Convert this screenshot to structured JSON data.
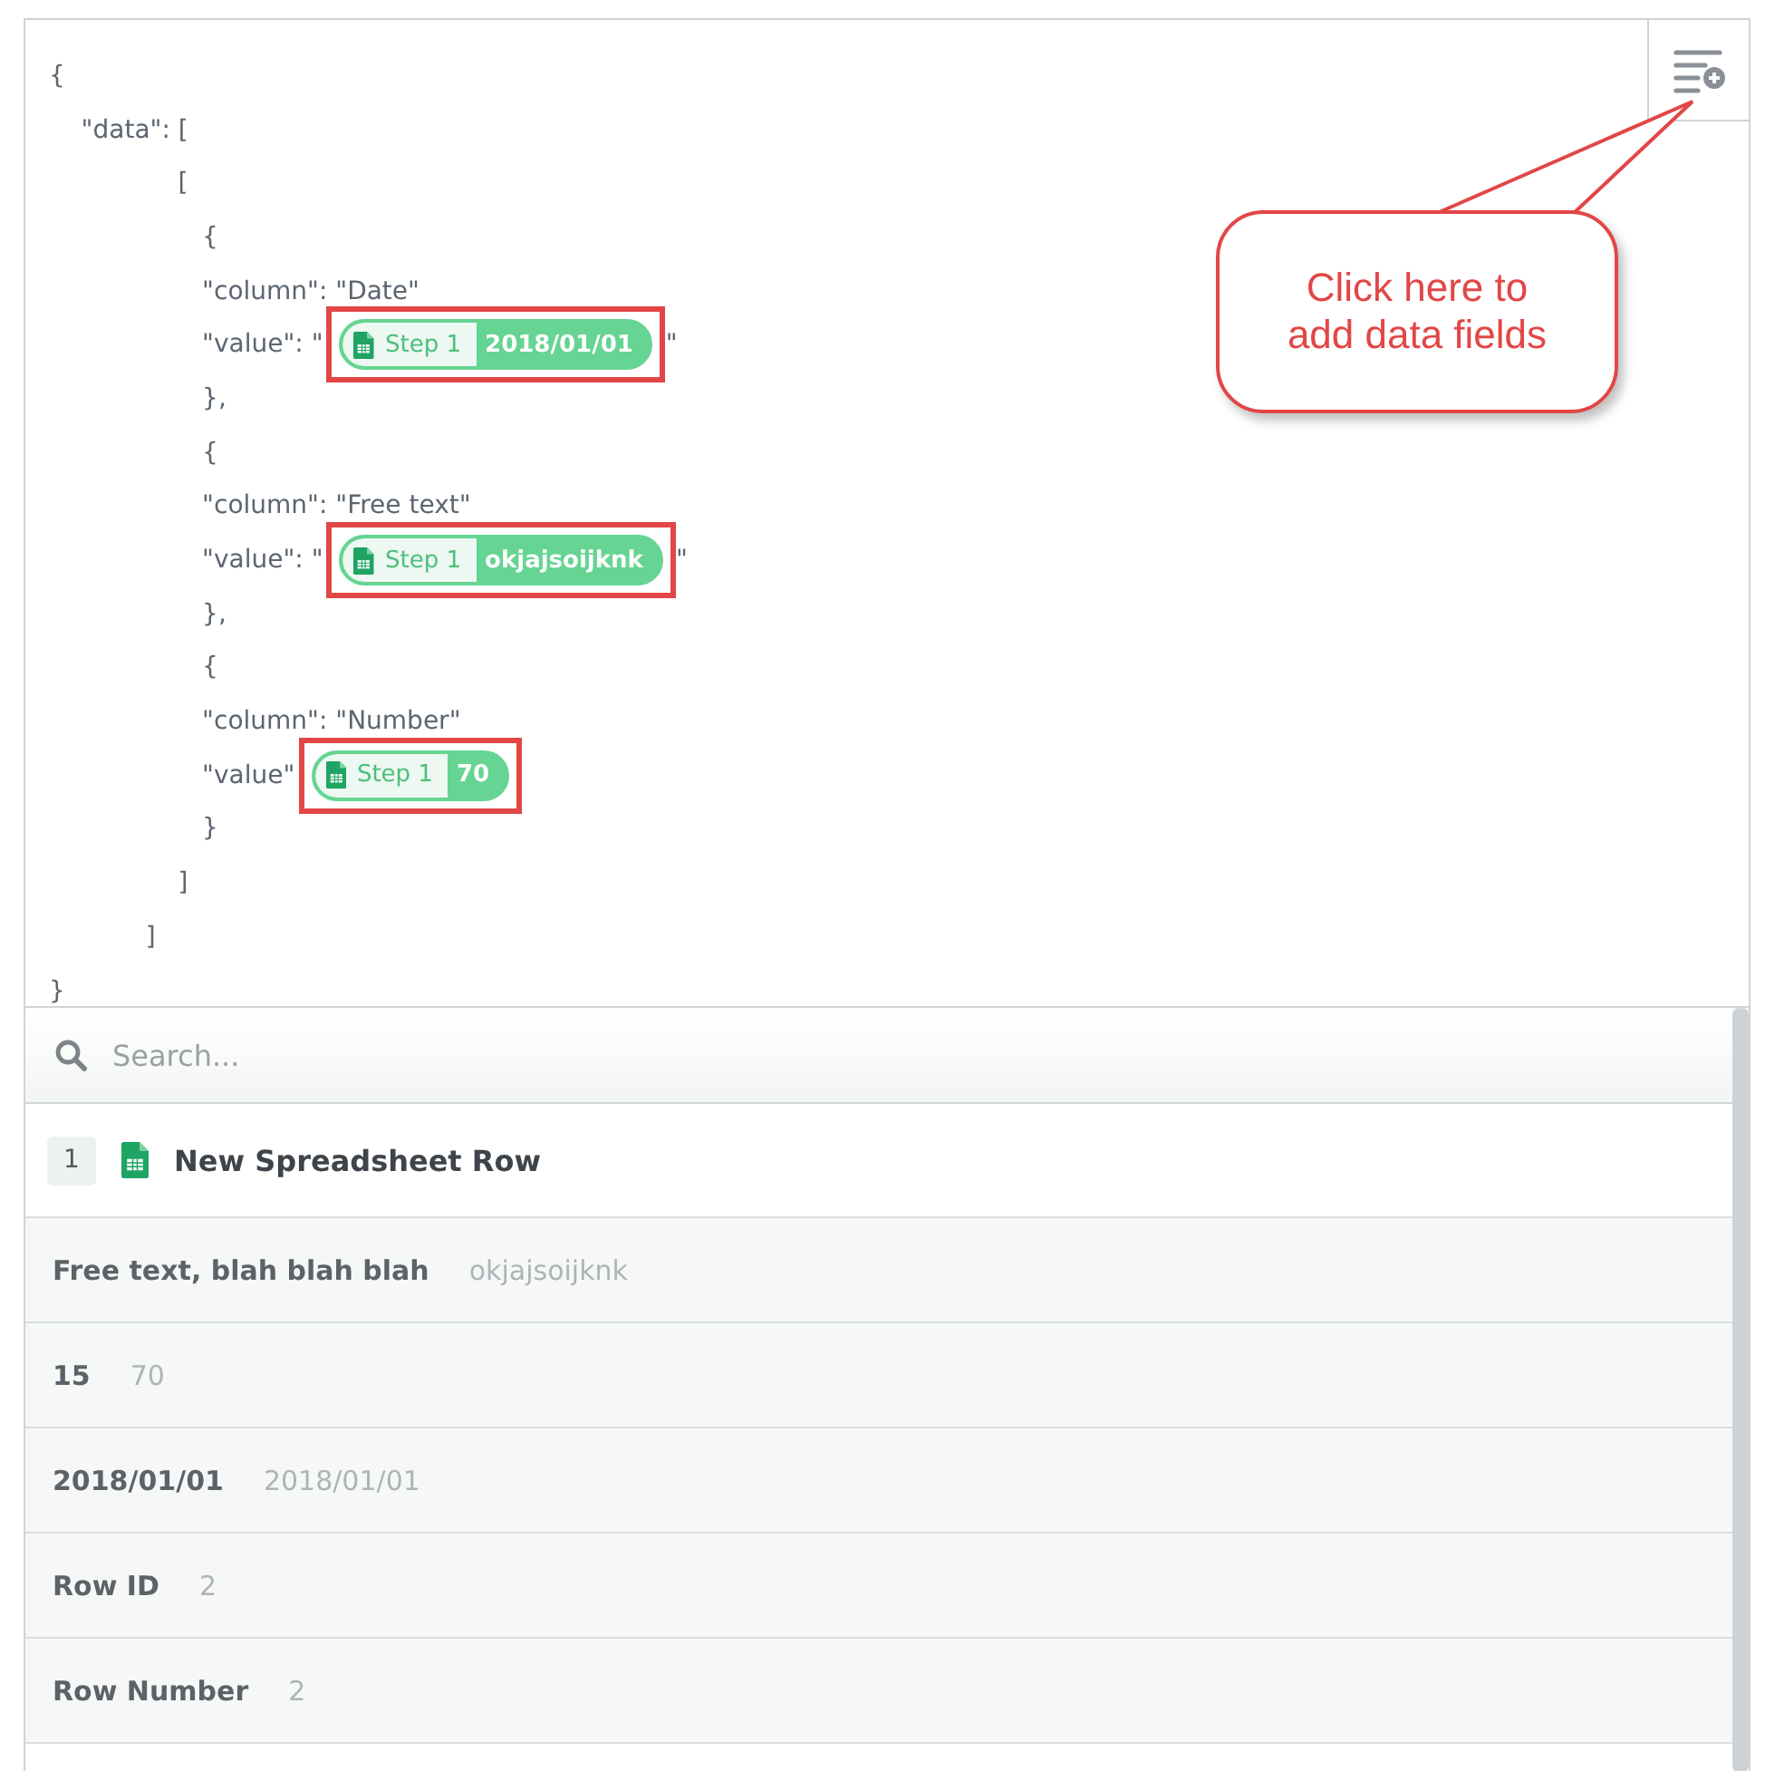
{
  "editor": {
    "lines": [
      [
        {
          "text": "{"
        }
      ],
      [
        {
          "text": "    \"data\": ["
        }
      ],
      [
        {
          "text": "                ["
        }
      ],
      [
        {
          "text": "                   {"
        }
      ],
      [
        {
          "text": "                   \"column\": \"Date\""
        }
      ],
      [
        {
          "text": "                   \"value\": \""
        },
        {
          "pill": {
            "step": "Step 1",
            "value": "2018/01/01",
            "annotated": true
          }
        },
        {
          "text": "\""
        }
      ],
      [
        {
          "text": "                   },"
        }
      ],
      [
        {
          "text": "                   {"
        }
      ],
      [
        {
          "text": "                   \"column\": \"Free text\""
        }
      ],
      [
        {
          "text": "                   \"value\": \""
        },
        {
          "pill": {
            "step": "Step 1",
            "value": "okjajsoijknk",
            "annotated": true
          }
        },
        {
          "text": "\""
        }
      ],
      [
        {
          "text": "                   },"
        }
      ],
      [
        {
          "text": "                   {"
        }
      ],
      [
        {
          "text": "                   \"column\": \"Number\""
        }
      ],
      [
        {
          "text": "                   \"value\""
        },
        {
          "pill": {
            "step": "Step 1",
            "value": "70",
            "annotated": true
          }
        }
      ],
      [
        {
          "text": "                   }"
        }
      ],
      [
        {
          "text": "                ]"
        }
      ],
      [
        {
          "text": "            ]"
        }
      ],
      [
        {
          "text": "}"
        }
      ]
    ]
  },
  "callout": {
    "text": "Click here to add data fields"
  },
  "search": {
    "placeholder": "Search..."
  },
  "step": {
    "number": "1",
    "title": "New Spreadsheet Row"
  },
  "fields": [
    {
      "label": "Free text, blah blah blah",
      "value": "okjajsoijknk"
    },
    {
      "label": "15",
      "value": "70"
    },
    {
      "label": "2018/01/01",
      "value": "2018/01/01"
    },
    {
      "label": "Row ID",
      "value": "2"
    },
    {
      "label": "Row Number",
      "value": "2"
    }
  ]
}
